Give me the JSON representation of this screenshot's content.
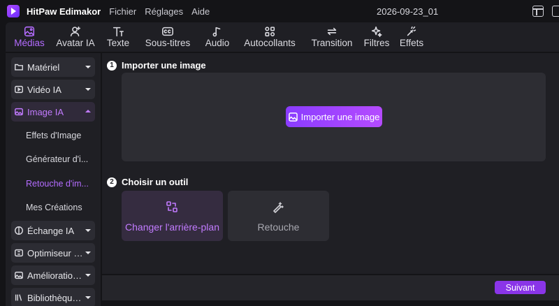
{
  "app": {
    "name": "HitPaw Edimakor",
    "menu": [
      "Fichier",
      "Réglages",
      "Aide"
    ],
    "project_name": "2026-09-23_01"
  },
  "toolbar": {
    "tabs": [
      {
        "label": "Médias",
        "icon": "image-icon",
        "active": true
      },
      {
        "label": "Avatar IA",
        "icon": "user-plus-icon",
        "active": false
      },
      {
        "label": "Texte",
        "icon": "text-icon",
        "active": false
      },
      {
        "label": "Sous-titres",
        "icon": "captions-icon",
        "active": false
      },
      {
        "label": "Audio",
        "icon": "music-note-icon",
        "active": false
      },
      {
        "label": "Autocollants",
        "icon": "shapes-icon",
        "active": false
      },
      {
        "label": "Transition",
        "icon": "arrows-icon",
        "active": false
      },
      {
        "label": "Filtres",
        "icon": "sparkles-icon",
        "active": false
      },
      {
        "label": "Effets",
        "icon": "magic-wand-icon",
        "active": false
      }
    ]
  },
  "sidebar": {
    "categories": [
      {
        "label": "Matériel",
        "icon": "folder-icon",
        "open": false
      },
      {
        "label": "Vidéo IA",
        "icon": "video-icon",
        "open": false
      },
      {
        "label": "Image IA",
        "icon": "image-ai-icon",
        "open": true
      },
      {
        "label": "Échange IA",
        "icon": "face-swap-icon",
        "open": false
      },
      {
        "label": "Optimiseur Vi...",
        "icon": "optimizer-icon",
        "open": false
      },
      {
        "label": "Amélioration ...",
        "icon": "enhance-icon",
        "open": false
      },
      {
        "label": "Bibliothèque ...",
        "icon": "library-icon",
        "open": false
      }
    ],
    "subitems": [
      {
        "label": "Effets d'Image",
        "active": false
      },
      {
        "label": "Générateur d'i...",
        "active": false
      },
      {
        "label": "Retouche d'im...",
        "active": true
      },
      {
        "label": "Mes Créations",
        "active": false
      }
    ]
  },
  "main": {
    "step1": {
      "number": "1",
      "title": "Importer une image"
    },
    "import_button": "Importer une image",
    "step2": {
      "number": "2",
      "title": "Choisir un outil"
    },
    "tools": [
      {
        "label": "Changer l'arrière-plan",
        "icon": "background-swap-icon",
        "selected": true
      },
      {
        "label": "Retouche",
        "icon": "retouch-wand-icon",
        "selected": false
      }
    ]
  },
  "footer": {
    "next_button": "Suivant"
  },
  "colors": {
    "accent": "#b46cff",
    "button": "#8a35e8",
    "panel": "#1f1f24",
    "card": "#2d2d33"
  }
}
